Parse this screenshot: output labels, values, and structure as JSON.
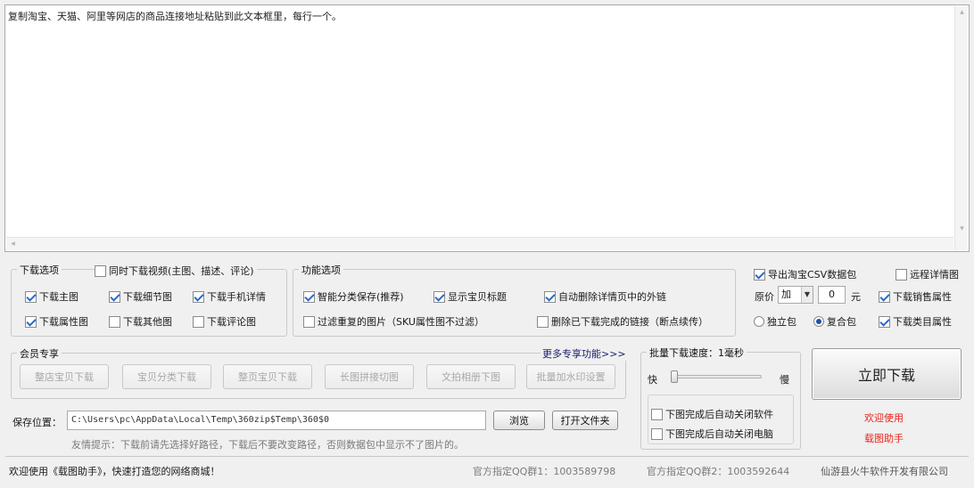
{
  "url_input": {
    "placeholder_text": "复制淘宝、天猫、阿里等网店的商品连接地址粘贴到此文本框里，每行一个。"
  },
  "download_options": {
    "title": "下载选项",
    "sync_video": {
      "label": "同时下载视频(主图、描述、评论)",
      "checked": false
    },
    "items": [
      {
        "label": "下载主图",
        "checked": true
      },
      {
        "label": "下载细节图",
        "checked": true
      },
      {
        "label": "下载手机详情",
        "checked": true
      },
      {
        "label": "下载属性图",
        "checked": true
      },
      {
        "label": "下载其他图",
        "checked": false
      },
      {
        "label": "下载评论图",
        "checked": false
      }
    ]
  },
  "feature_options": {
    "title": "功能选项",
    "items": [
      {
        "label": "智能分类保存(推荐)",
        "checked": true
      },
      {
        "label": "显示宝贝标题",
        "checked": true
      },
      {
        "label": "自动删除详情页中的外链",
        "checked": true
      },
      {
        "label": "过滤重复的图片（SKU属性图不过滤）",
        "checked": false
      },
      {
        "label": "删除已下载完成的链接（断点续传）",
        "checked": false
      }
    ]
  },
  "csv_options": {
    "export_csv": {
      "label": "导出淘宝CSV数据包",
      "checked": true
    },
    "remote_detail": {
      "label": "远程详情图",
      "checked": false
    },
    "price_label": "原价",
    "price_op": "加",
    "price_value": "0",
    "price_unit": "元",
    "sales_attr": {
      "label": "下载销售属性",
      "checked": true
    },
    "category_attr": {
      "label": "下载类目属性",
      "checked": true
    },
    "pack_standalone": {
      "label": "独立包",
      "selected": false
    },
    "pack_composite": {
      "label": "复合包",
      "selected": true
    }
  },
  "member": {
    "title": "会员专享",
    "more_link": "更多专享功能>>>",
    "buttons": [
      "整店宝贝下载",
      "宝贝分类下载",
      "整页宝贝下载",
      "长图拼接切图",
      "文拍相册下图",
      "批量加水印设置"
    ]
  },
  "speed": {
    "title": "批量下载速度：1毫秒",
    "fast": "快",
    "slow": "慢",
    "level": 0.0,
    "close_software": {
      "label": "下图完成后自动关闭软件",
      "checked": false
    },
    "shutdown_pc": {
      "label": "下图完成后自动关闭电脑",
      "checked": false
    }
  },
  "save": {
    "label": "保存位置：",
    "path": "C:\\Users\\pc\\AppData\\Local\\Temp\\360zip$Temp\\360$0",
    "browse_label": "浏览",
    "open_folder_label": "打开文件夹",
    "tip": "友情提示：下载前请先选择好路径，下载后不要改变路径，否则数据包中显示不了图片的。"
  },
  "download_button": "立即下载",
  "welcome": {
    "line1": "欢迎使用",
    "line2": "载图助手"
  },
  "status": {
    "welcome": "欢迎使用《载图助手》，快速打造您的网络商城！",
    "qq1": "官方指定QQ群1：1003589798",
    "qq2": "官方指定QQ群2：1003592644",
    "company": "仙游县火牛软件开发有限公司"
  },
  "colors": {
    "accent_red": "#e8261c",
    "check_blue": "#2a6cc6"
  }
}
